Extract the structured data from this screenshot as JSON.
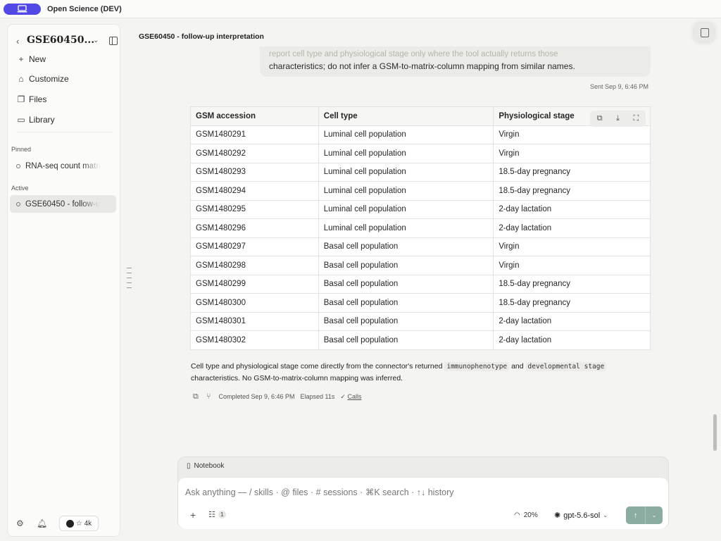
{
  "app": {
    "title": "Open Science (DEV)"
  },
  "sidebar": {
    "project_title": "GSE60450...",
    "nav": [
      {
        "icon": "plus-icon",
        "label": "New"
      },
      {
        "icon": "paint-icon",
        "label": "Customize"
      },
      {
        "icon": "files-icon",
        "label": "Files"
      },
      {
        "icon": "book-icon",
        "label": "Library"
      }
    ],
    "pinned_label": "Pinned",
    "pinned": [
      {
        "label": "RNA-seq count matri"
      }
    ],
    "active_label": "Active",
    "active": [
      {
        "label": "GSE60450 - follow-u"
      }
    ],
    "github_stars": "☆ 4k"
  },
  "main": {
    "title": "GSE60450 - follow-up interpretation",
    "user_message": {
      "faded_line": "report cell type and physiological stage only where the tool actually returns those",
      "last_line": "characteristics; do not infer a GSM-to-matrix-column mapping from similar names.",
      "sent": "Sent Sep 9, 6:46 PM"
    },
    "table": {
      "headers": [
        "GSM accession",
        "Cell type",
        "Physiological stage"
      ],
      "rows": [
        [
          "GSM1480291",
          "Luminal cell population",
          "Virgin"
        ],
        [
          "GSM1480292",
          "Luminal cell population",
          "Virgin"
        ],
        [
          "GSM1480293",
          "Luminal cell population",
          "18.5-day pregnancy"
        ],
        [
          "GSM1480294",
          "Luminal cell population",
          "18.5-day pregnancy"
        ],
        [
          "GSM1480295",
          "Luminal cell population",
          "2-day lactation"
        ],
        [
          "GSM1480296",
          "Luminal cell population",
          "2-day lactation"
        ],
        [
          "GSM1480297",
          "Basal cell population",
          "Virgin"
        ],
        [
          "GSM1480298",
          "Basal cell population",
          "Virgin"
        ],
        [
          "GSM1480299",
          "Basal cell population",
          "18.5-day pregnancy"
        ],
        [
          "GSM1480300",
          "Basal cell population",
          "18.5-day pregnancy"
        ],
        [
          "GSM1480301",
          "Basal cell population",
          "2-day lactation"
        ],
        [
          "GSM1480302",
          "Basal cell population",
          "2-day lactation"
        ]
      ]
    },
    "note": {
      "before": "Cell type and physiological stage come directly from the connector's returned",
      "code1": "immunophenotype",
      "mid": "and",
      "code2": "developmental stage",
      "after": "characteristics. No GSM-to-matrix-column mapping was inferred."
    },
    "meta": {
      "completed": "Completed Sep 9, 6:46 PM",
      "elapsed": "Elapsed 11s",
      "calls": "Calls"
    }
  },
  "composer": {
    "notebook_label": "Notebook",
    "placeholder": "Ask anything — / skills · @ files · # sessions · ⌘K search · ↑↓ history",
    "attachment_count": "1",
    "usage": "20%",
    "model": "gpt-5.6-sol"
  }
}
